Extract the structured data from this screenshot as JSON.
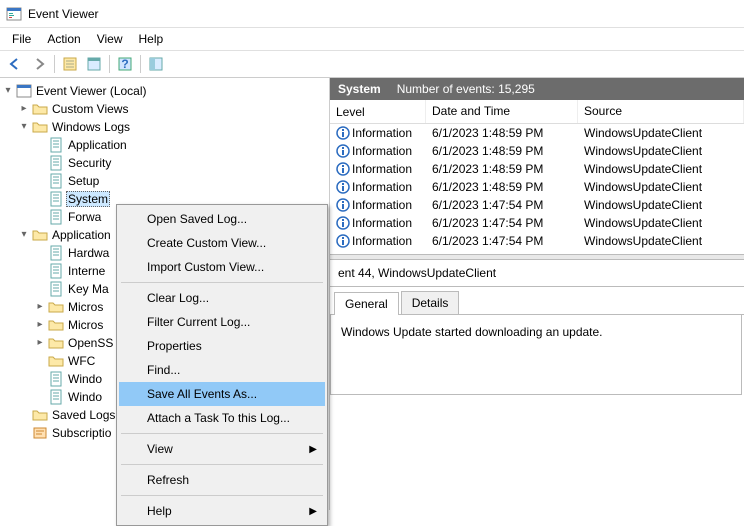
{
  "titlebar": {
    "title": "Event Viewer"
  },
  "menubar": {
    "file": "File",
    "action": "Action",
    "view": "View",
    "help": "Help"
  },
  "tree": {
    "root": "Event Viewer (Local)",
    "custom_views": "Custom Views",
    "windows_logs": "Windows Logs",
    "application": "Application",
    "security": "Security",
    "setup": "Setup",
    "system": "System",
    "forwarded": "Forwa",
    "app_services": "Application",
    "hardware": "Hardwa",
    "internet": "Interne",
    "keyma": "Key Ma",
    "micros1": "Micros",
    "micros2": "Micros",
    "openss": "OpenSS",
    "wfc": "WFC",
    "window1": "Windo",
    "window2": "Windo",
    "saved_logs": "Saved Logs",
    "subscriptions": "Subscriptio"
  },
  "content": {
    "header_name": "System",
    "header_count": "Number of events: 15,295",
    "columns": {
      "level": "Level",
      "date": "Date and Time",
      "source": "Source"
    },
    "rows": [
      {
        "level": "Information",
        "date": "6/1/2023 1:48:59 PM",
        "source": "WindowsUpdateClient"
      },
      {
        "level": "Information",
        "date": "6/1/2023 1:48:59 PM",
        "source": "WindowsUpdateClient"
      },
      {
        "level": "Information",
        "date": "6/1/2023 1:48:59 PM",
        "source": "WindowsUpdateClient"
      },
      {
        "level": "Information",
        "date": "6/1/2023 1:48:59 PM",
        "source": "WindowsUpdateClient"
      },
      {
        "level": "Information",
        "date": "6/1/2023 1:47:54 PM",
        "source": "WindowsUpdateClient"
      },
      {
        "level": "Information",
        "date": "6/1/2023 1:47:54 PM",
        "source": "WindowsUpdateClient"
      },
      {
        "level": "Information",
        "date": "6/1/2023 1:47:54 PM",
        "source": "WindowsUpdateClient"
      }
    ],
    "detail_title": "ent 44, WindowsUpdateClient",
    "tab_general": "General",
    "tab_details": "Details",
    "detail_body": "Windows Update started downloading an update."
  },
  "contextmenu": {
    "open_saved": "Open Saved Log...",
    "create_custom": "Create Custom View...",
    "import_custom": "Import Custom View...",
    "clear_log": "Clear Log...",
    "filter_log": "Filter Current Log...",
    "properties": "Properties",
    "find": "Find...",
    "save_all": "Save All Events As...",
    "attach_task": "Attach a Task To this Log...",
    "view": "View",
    "refresh": "Refresh",
    "help": "Help"
  }
}
